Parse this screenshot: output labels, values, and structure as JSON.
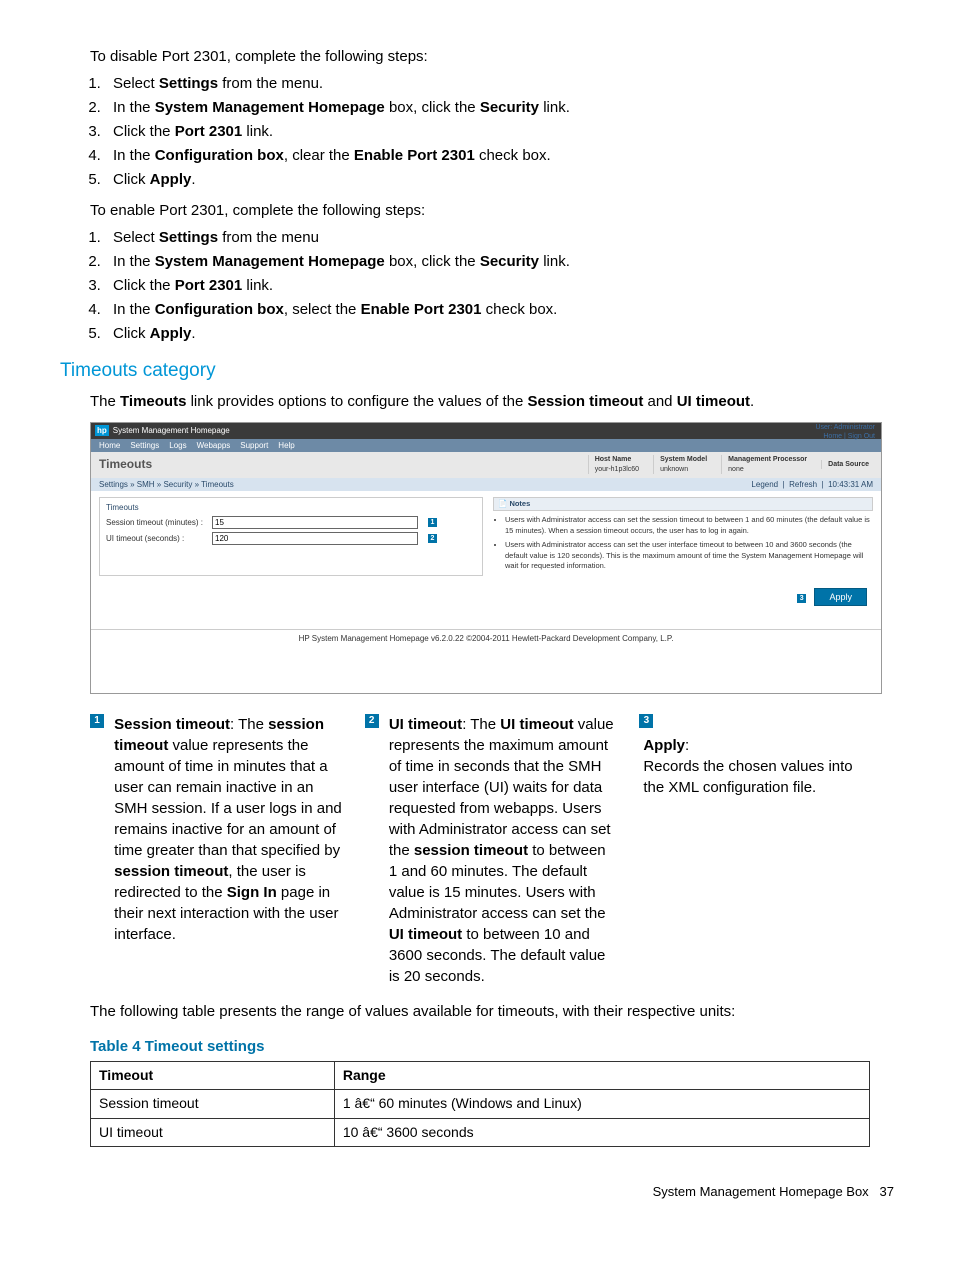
{
  "para_disable": "To disable Port 2301, complete the following steps:",
  "steps_disable": {
    "s1_a": "Select ",
    "s1_b": "Settings",
    "s1_c": " from the menu.",
    "s2_a": "In the ",
    "s2_b": "System Management Homepage",
    "s2_c": " box, click the ",
    "s2_d": "Security",
    "s2_e": " link.",
    "s3_a": "Click the ",
    "s3_b": "Port 2301",
    "s3_c": " link.",
    "s4_a": "In the ",
    "s4_b": "Configuration box",
    "s4_c": ", clear the ",
    "s4_d": "Enable Port 2301",
    "s4_e": " check box.",
    "s5_a": "Click ",
    "s5_b": "Apply",
    "s5_c": "."
  },
  "para_enable": "To enable Port 2301, complete the following steps:",
  "steps_enable": {
    "s1_a": "Select ",
    "s1_b": "Settings",
    "s1_c": " from the menu",
    "s2_a": "In the ",
    "s2_b": "System Management Homepage",
    "s2_c": " box, click the ",
    "s2_d": "Security",
    "s2_e": " link.",
    "s3_a": "Click the ",
    "s3_b": "Port 2301",
    "s3_c": " link.",
    "s4_a": "In the ",
    "s4_b": "Configuration box",
    "s4_c": ", select the ",
    "s4_d": "Enable Port 2301",
    "s4_e": " check box.",
    "s5_a": "Click ",
    "s5_b": "Apply",
    "s5_c": "."
  },
  "heading_timeouts": "Timeouts category",
  "para_timeouts_a": "The ",
  "para_timeouts_b": "Timeouts",
  "para_timeouts_c": " link provides options to configure the values of the ",
  "para_timeouts_d": "Session timeout",
  "para_timeouts_e": " and ",
  "para_timeouts_f": "UI timeout",
  "para_timeouts_g": ".",
  "shot": {
    "window_title": "System Management Homepage",
    "hp": "hp",
    "user_line1": "User: Administrator",
    "user_line2": "Home | Sign Out",
    "menu": [
      "Home",
      "Settings",
      "Logs",
      "Webapps",
      "Support",
      "Help"
    ],
    "heading": "Timeouts",
    "crumb": "Settings » SMH » Security » Timeouts",
    "host_name_l": "Host Name",
    "host_name_v": "your-h1p3lc60",
    "sys_model_l": "System Model",
    "sys_model_v": "unknown",
    "mp_l": "Management Processor",
    "mp_v": "none",
    "ds_l": "Data Source",
    "legend": "Legend",
    "refresh": "Refresh",
    "time": "10:43:31 AM",
    "group": "Timeouts",
    "f1_label": "Session timeout (minutes) :",
    "f1_value": "15",
    "f2_label": "UI timeout (seconds) :",
    "f2_value": "120",
    "notes_h": "Notes",
    "note1": "Users with Administrator access can set the session timeout to between 1 and 60 minutes (the default value is 15 minutes). When a session timeout occurs, the user has to log in again.",
    "note2": "Users with Administrator access can set the user interface timeout to between 10 and 3600 seconds (the default value is 120 seconds). This is the maximum amount of time the System Management Homepage will wait for requested information.",
    "apply": "Apply",
    "footer": "HP System Management Homepage v6.2.0.22    ©2004-2011 Hewlett-Packard Development Company, L.P."
  },
  "callouts": {
    "n1": "1",
    "n2": "2",
    "n3": "3",
    "c1_a": "Session timeout",
    "c1_b": ": The ",
    "c1_c": "session timeout",
    "c1_d": " value represents the amount of time in minutes that a user can remain inactive in an SMH session. If a user logs in and remains inactive for an amount of time greater than that specified by ",
    "c1_e": "session timeout",
    "c1_f": ", the user is redirected to the ",
    "c1_g": "Sign In",
    "c1_h": " page in their next interaction with the user interface.",
    "c2_a": "UI timeout",
    "c2_b": ": The ",
    "c2_c": "UI timeout",
    "c2_d": " value represents the maximum amount of time in seconds that the SMH user interface (UI) waits for data requested from webapps. Users with Administrator access can set the ",
    "c2_e": "session timeout",
    "c2_f": " to between 1 and 60 minutes. The default value is 15 minutes. Users with Administrator access can set the ",
    "c2_g": "UI timeout",
    "c2_h": "  to between 10 and 3600 seconds. The default value is 20 seconds.",
    "c3_a": "Apply",
    "c3_b": ":",
    "c3_c": "Records the chosen values into the XML configuration file."
  },
  "para_table": "The following table presents the range of values available for timeouts, with their respective units:",
  "table_caption": "Table 4 Timeout settings",
  "table": {
    "h1": "Timeout",
    "h2": "Range",
    "r1c1": "Session timeout",
    "r1c2": "1 â€“ 60 minutes (Windows and Linux)",
    "r2c1": "UI timeout",
    "r2c2": "10 â€“ 3600 seconds"
  },
  "footer_text": "System Management Homepage Box",
  "footer_page": "37"
}
